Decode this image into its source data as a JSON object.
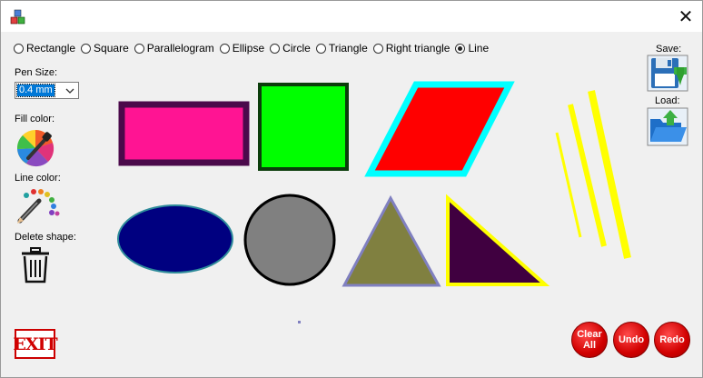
{
  "title_bar": {
    "close_glyph": "✕"
  },
  "shape_options": [
    {
      "label": "Rectangle",
      "checked": false
    },
    {
      "label": "Square",
      "checked": false
    },
    {
      "label": "Parallelogram",
      "checked": false
    },
    {
      "label": "Ellipse",
      "checked": false
    },
    {
      "label": "Circle",
      "checked": false
    },
    {
      "label": "Triangle",
      "checked": false
    },
    {
      "label": "Right triangle",
      "checked": false
    },
    {
      "label": "Line",
      "checked": true
    }
  ],
  "left_panel": {
    "pen_size_label": "Pen Size:",
    "pen_size_value": "0.4 mm",
    "fill_color_label": "Fill color:",
    "line_color_label": "Line color:",
    "delete_shape_label": "Delete shape:"
  },
  "right_panel": {
    "save_label": "Save:",
    "load_label": "Load:"
  },
  "buttons": {
    "clear_all_line1": "Clear",
    "clear_all_line2": "All",
    "undo": "Undo",
    "redo": "Redo",
    "exit": "EXIT"
  },
  "icons": [
    "app-icon",
    "close-icon",
    "dropdown-arrow-icon",
    "color-picker-icon",
    "line-color-icon",
    "trash-icon",
    "save-disk-icon",
    "load-folder-icon"
  ],
  "colors": {
    "rectangle_fill": "#ff1493",
    "rectangle_border": "#4b0a4b",
    "square_fill": "#00ff00",
    "square_border": "#0b3d0b",
    "parallelogram_fill": "#ff0000",
    "parallelogram_border": "#00ffff",
    "ellipse_fill": "#000080",
    "ellipse_border": "#2e8b9a",
    "circle_fill": "#808080",
    "circle_border": "#000000",
    "triangle_fill": "#808040",
    "triangle_border": "#8080c0",
    "right_triangle_fill": "#400040",
    "right_triangle_border": "#ffff00",
    "line_color": "#ffff00",
    "dot_color": "#8080c0",
    "button_red": "#d10000"
  }
}
